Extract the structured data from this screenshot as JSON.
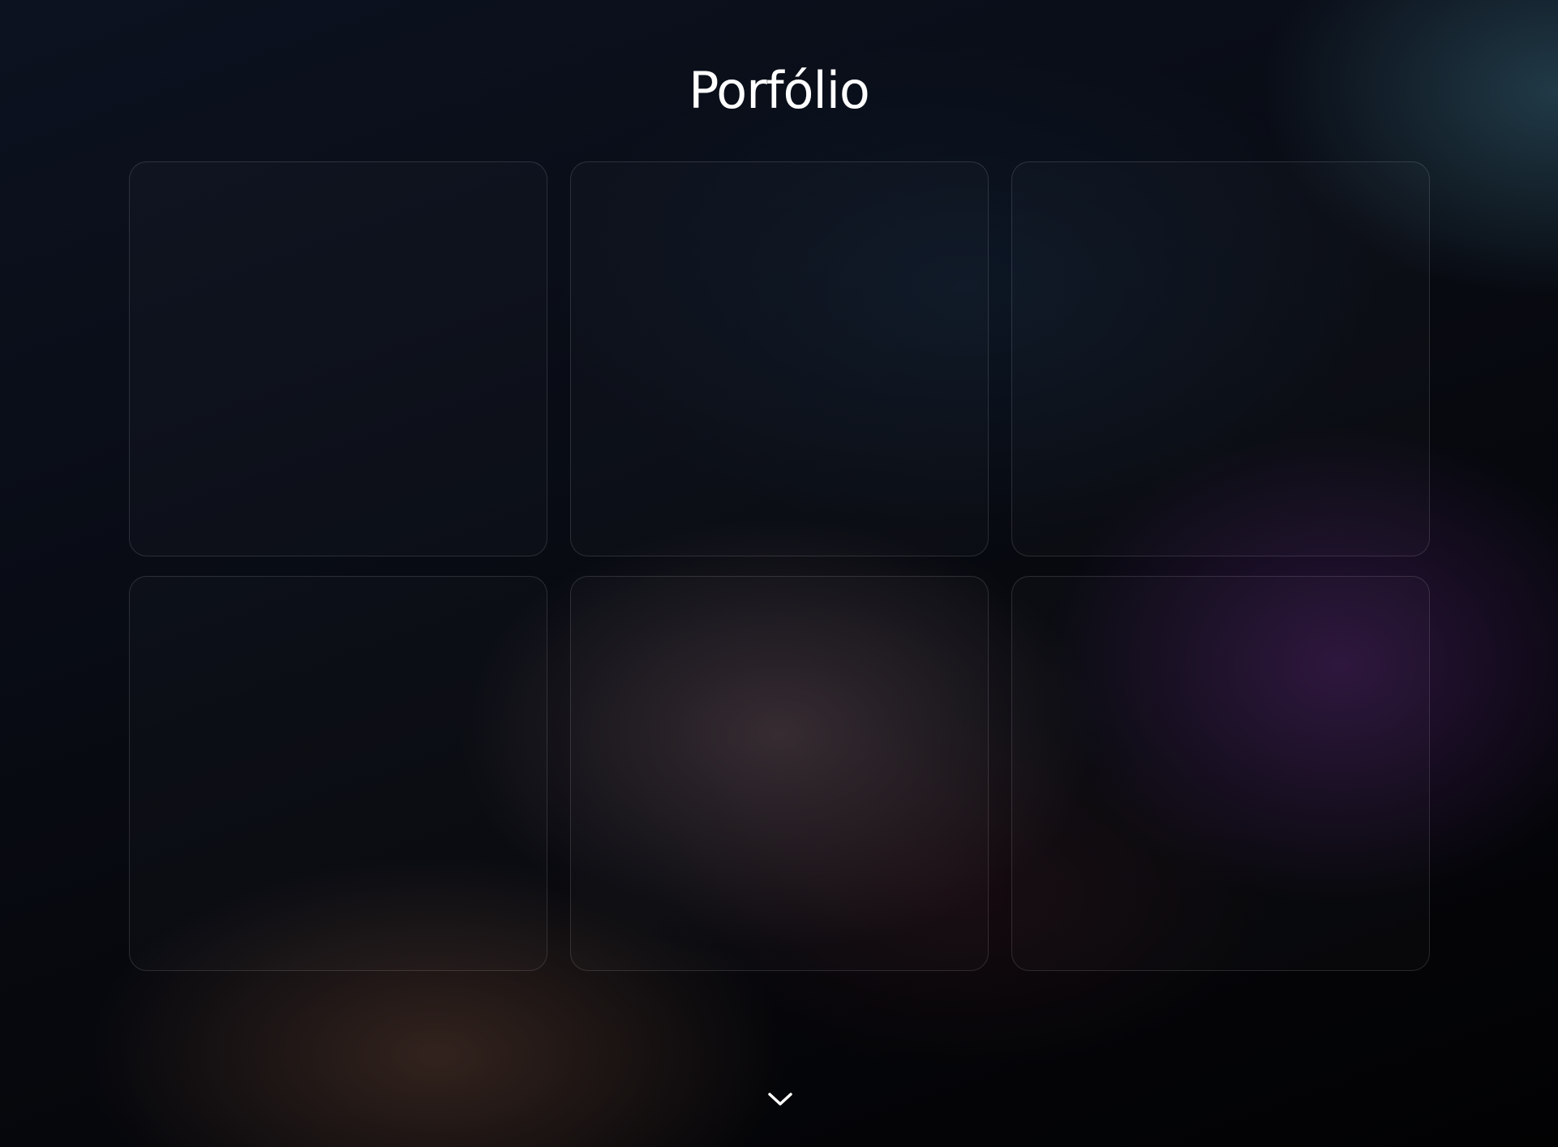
{
  "header": {
    "title": "Porfólio"
  },
  "portfolio": {
    "items": [
      {
        "label": ""
      },
      {
        "label": ""
      },
      {
        "label": ""
      },
      {
        "label": ""
      },
      {
        "label": ""
      },
      {
        "label": ""
      }
    ]
  },
  "scroll_indicator": {
    "icon": "chevron-down-icon",
    "color": "#ffffff"
  }
}
